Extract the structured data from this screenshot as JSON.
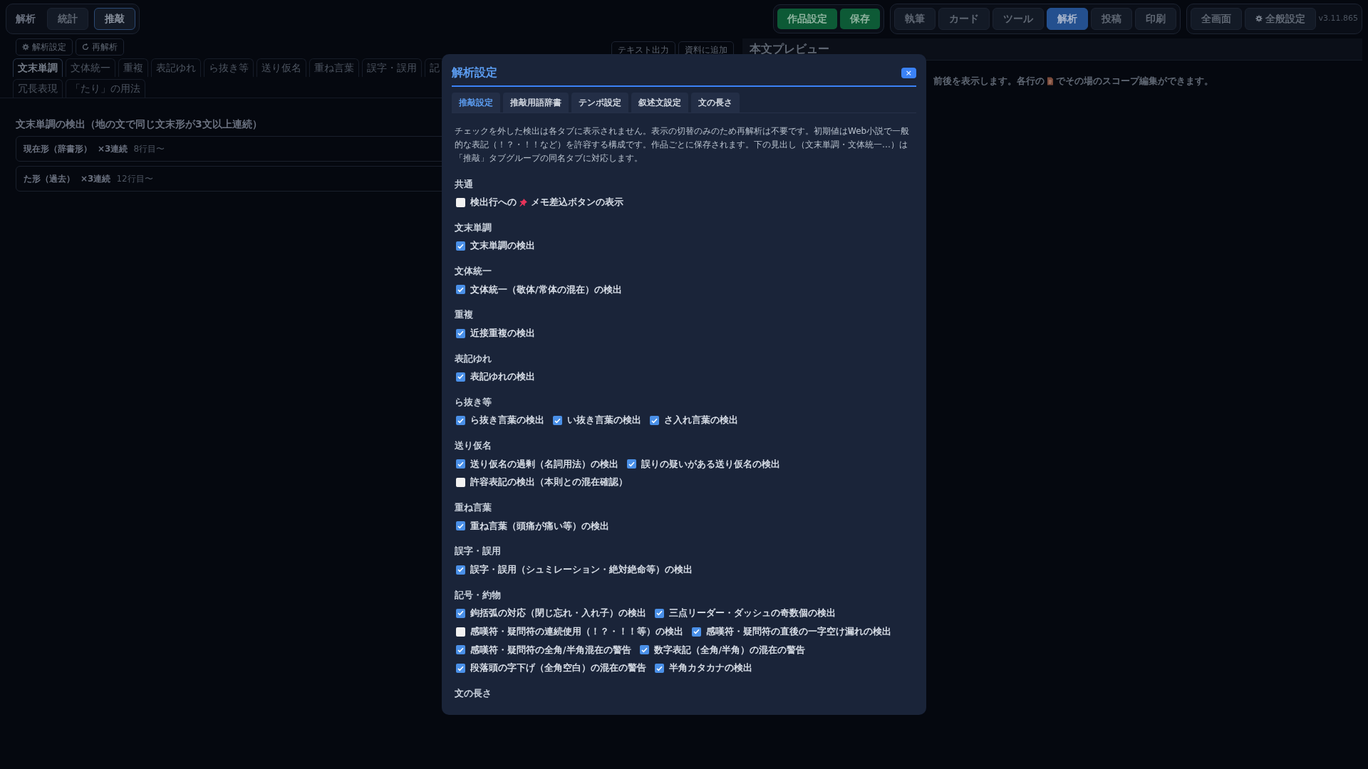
{
  "top_bar": {
    "app_label": "解析",
    "mode_tabs": [
      {
        "label": "統計",
        "selected": false
      },
      {
        "label": "推敲",
        "selected": true
      }
    ],
    "project_buttons": [
      "作品設定",
      "保存"
    ],
    "view_tabs": [
      {
        "label": "執筆",
        "selected": false
      },
      {
        "label": "カード",
        "selected": false
      },
      {
        "label": "ツール",
        "selected": false
      },
      {
        "label": "解析",
        "selected": true
      },
      {
        "label": "投稿",
        "selected": false
      },
      {
        "label": "印刷",
        "selected": false
      }
    ],
    "fullscreen_button": "全画面",
    "settings_button": "全般設定",
    "version": "v3.11.865"
  },
  "toolbar": {
    "settings_button": "解析設定",
    "reanalyze_button": "再解析"
  },
  "analysis_tabs": [
    {
      "label": "文末単調",
      "selected": true
    },
    {
      "label": "文体統一",
      "selected": false
    },
    {
      "label": "重複",
      "selected": false
    },
    {
      "label": "表記ゆれ",
      "selected": false
    },
    {
      "label": "ら抜き等",
      "selected": false
    },
    {
      "label": "送り仮名",
      "selected": false
    },
    {
      "label": "重ね言葉",
      "selected": false
    },
    {
      "label": "誤字・誤用",
      "selected": false
    },
    {
      "label": "記",
      "selected": false
    },
    {
      "label": "冗長表現",
      "selected": false
    },
    {
      "label": "「たり」の用法",
      "selected": false
    }
  ],
  "result": {
    "heading": "文末単調の検出（地の文で同じ文末形が3文以上連続）",
    "rows": [
      {
        "label": "現在形（辞書形）",
        "count": "×3連続",
        "location": "8行目〜"
      },
      {
        "label": "た形（過去）",
        "count": "×3連続",
        "location": "12行目〜"
      }
    ]
  },
  "preview": {
    "buttons": [
      "テキスト出力",
      "資料に追加"
    ],
    "title": "本文プレビュー",
    "hint_before": "前後を表示します。各行の",
    "hint_after": "でその場のスコープ編集ができます。"
  },
  "dialog": {
    "title": "解析設定",
    "close": "×",
    "tabs": [
      {
        "label": "推敲設定",
        "selected": true
      },
      {
        "label": "推敲用語辞書",
        "selected": false
      },
      {
        "label": "テンポ設定",
        "selected": false
      },
      {
        "label": "叙述文設定",
        "selected": false
      },
      {
        "label": "文の長さ",
        "selected": false
      }
    ],
    "description": "チェックを外した検出は各タブに表示されません。表示の切替のみのため再解析は不要です。初期値はWeb小説で一般的な表記（！？・！！など）を許容する構成です。作品ごとに保存されます。下の見出し（文末単調・文体統一…）は「推敲」タブグループの同名タブに対応します。",
    "sections": [
      {
        "heading": "共通",
        "lines": [
          [
            {
              "label": "検出行への",
              "label_after_pin": "メモ差込ボタンの表示",
              "checked": false
            }
          ]
        ]
      },
      {
        "heading": "文末単調",
        "lines": [
          [
            {
              "label": "文末単調の検出",
              "checked": true
            }
          ]
        ]
      },
      {
        "heading": "文体統一",
        "lines": [
          [
            {
              "label": "文体統一（敬体/常体の混在）の検出",
              "checked": true
            }
          ]
        ]
      },
      {
        "heading": "重複",
        "lines": [
          [
            {
              "label": "近接重複の検出",
              "checked": true
            }
          ]
        ]
      },
      {
        "heading": "表記ゆれ",
        "lines": [
          [
            {
              "label": "表記ゆれの検出",
              "checked": true
            }
          ]
        ]
      },
      {
        "heading": "ら抜き等",
        "lines": [
          [
            {
              "label": "ら抜き言葉の検出",
              "checked": true
            },
            {
              "label": "い抜き言葉の検出",
              "checked": true
            },
            {
              "label": "さ入れ言葉の検出",
              "checked": true
            }
          ]
        ]
      },
      {
        "heading": "送り仮名",
        "lines": [
          [
            {
              "label": "送り仮名の過剰（名詞用法）の検出",
              "checked": true
            },
            {
              "label": "誤りの疑いがある送り仮名の検出",
              "checked": true
            }
          ],
          [
            {
              "label": "許容表記の検出（本則との混在確認）",
              "checked": false
            }
          ]
        ]
      },
      {
        "heading": "重ね言葉",
        "lines": [
          [
            {
              "label": "重ね言葉（頭痛が痛い等）の検出",
              "checked": true
            }
          ]
        ]
      },
      {
        "heading": "誤字・誤用",
        "lines": [
          [
            {
              "label": "誤字・誤用（シュミレーション・絶対絶命等）の検出",
              "checked": true
            }
          ]
        ]
      },
      {
        "heading": "記号・約物",
        "lines": [
          [
            {
              "label": "鉤括弧の対応（閉じ忘れ・入れ子）の検出",
              "checked": true
            },
            {
              "label": "三点リーダー・ダッシュの奇数個の検出",
              "checked": true
            }
          ],
          [
            {
              "label": "感嘆符・疑問符の連続使用（！？・！！等）の検出",
              "checked": false
            },
            {
              "label": "感嘆符・疑問符の直後の一字空け漏れの検出",
              "checked": true
            }
          ],
          [
            {
              "label": "感嘆符・疑問符の全角/半角混在の警告",
              "checked": true
            },
            {
              "label": "数字表記（全角/半角）の混在の警告",
              "checked": true
            }
          ],
          [
            {
              "label": "段落頭の字下げ（全角空白）の混在の警告",
              "checked": true
            },
            {
              "label": "半角カタカナの検出",
              "checked": true
            }
          ]
        ]
      },
      {
        "heading": "文の長さ"
      }
    ]
  }
}
